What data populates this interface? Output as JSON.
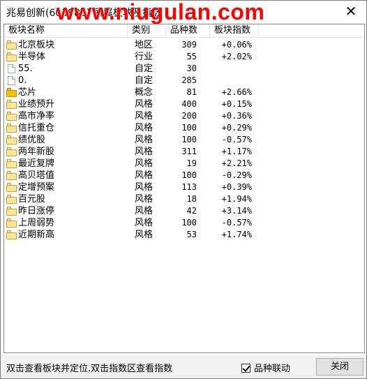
{
  "window": {
    "title": "兆易创新(603986) 所属板块及指数",
    "watermark": "www.niugulan.com"
  },
  "table": {
    "columns": [
      "板块名称",
      "类别",
      "品种数",
      "板块指数"
    ],
    "rows": [
      {
        "icon": "folder-icon",
        "name": "北京板块",
        "type": "地区",
        "count": "309",
        "index": "+0.06%"
      },
      {
        "icon": "folder-icon",
        "name": "半导体",
        "type": "行业",
        "count": "55",
        "index": "+2.02%"
      },
      {
        "icon": "document-icon",
        "name": "55.",
        "type": "自定",
        "count": "30",
        "index": ""
      },
      {
        "icon": "document-icon",
        "name": "0.",
        "type": "自定",
        "count": "285",
        "index": ""
      },
      {
        "icon": "folder-filled-icon",
        "name": "芯片",
        "type": "概念",
        "count": "81",
        "index": "+2.66%"
      },
      {
        "icon": "folder-icon",
        "name": "业绩预升",
        "type": "风格",
        "count": "400",
        "index": "+0.15%"
      },
      {
        "icon": "folder-icon",
        "name": "高市净率",
        "type": "风格",
        "count": "200",
        "index": "+0.36%"
      },
      {
        "icon": "folder-icon",
        "name": "信托重仓",
        "type": "风格",
        "count": "100",
        "index": "+0.29%"
      },
      {
        "icon": "folder-icon",
        "name": "绩优股",
        "type": "风格",
        "count": "100",
        "index": "-0.57%"
      },
      {
        "icon": "folder-icon",
        "name": "两年新股",
        "type": "风格",
        "count": "311",
        "index": "+1.17%"
      },
      {
        "icon": "folder-icon",
        "name": "最近复牌",
        "type": "风格",
        "count": "19",
        "index": "+2.21%"
      },
      {
        "icon": "folder-icon",
        "name": "高贝塔值",
        "type": "风格",
        "count": "100",
        "index": "-0.29%"
      },
      {
        "icon": "folder-icon",
        "name": "定增预案",
        "type": "风格",
        "count": "113",
        "index": "+0.39%"
      },
      {
        "icon": "folder-icon",
        "name": "百元股",
        "type": "风格",
        "count": "18",
        "index": "+1.94%"
      },
      {
        "icon": "folder-icon",
        "name": "昨日涨停",
        "type": "风格",
        "count": "42",
        "index": "+3.14%"
      },
      {
        "icon": "folder-icon",
        "name": "上周弱势",
        "type": "风格",
        "count": "100",
        "index": "-0.57%"
      },
      {
        "icon": "folder-icon",
        "name": "近期新高",
        "type": "风格",
        "count": "53",
        "index": "+1.74%"
      }
    ]
  },
  "footer": {
    "hint": "双击查看板块并定位.双击指数区查看指数",
    "linkage_label": "品种联动",
    "linkage_checked": true,
    "close_label": "关闭"
  }
}
